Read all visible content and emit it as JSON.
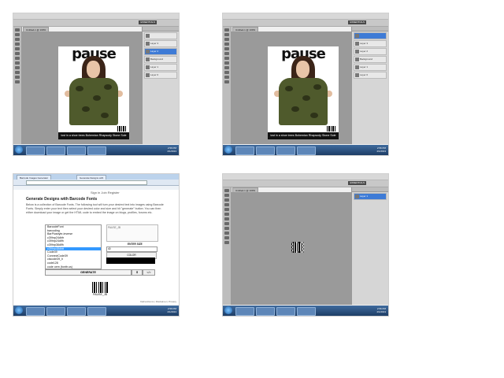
{
  "photoshop": {
    "menus": [
      "File",
      "Edit",
      "Image",
      "Layer",
      "Select",
      "Filter",
      "Analysis",
      "3D",
      "View",
      "Window",
      "Help"
    ],
    "workspace_label": "ESSENTIALS",
    "doc_tab": "Untitled-1 @ 100%",
    "layers_shot1": [
      "",
      "Layer 3",
      "Layer 2",
      "Background",
      "Layer 1",
      "Layer 0"
    ],
    "layers_shot2": [
      "",
      "Layer 3",
      "Layer 2",
      "Background",
      "Layer 1",
      "Layer 0"
    ],
    "layers_shot4": [
      "Layer 1"
    ]
  },
  "poster": {
    "title": "pause",
    "caption": "lost in a shoe trees   Bohemian Rhapsody   Stone Sole"
  },
  "taskbar": {
    "time": "2:56 PM",
    "date": "4/1/2013"
  },
  "browser": {
    "tab1": "Barcode Images Generator",
    "tab2": "Generate Designs with",
    "url": "",
    "bookmarks": "",
    "signin": "Sign in  Join  Register",
    "title": "Generate Designs with Barcode Fonts",
    "description": "Below is a collection of Barcode Fonts. The following tool will turn your desired text into images using Barcode Fonts. Simply enter your text then select your desired color and size and hit \"generate\" button. You can then either download your image or get the HTML code to embed the image on blogs, profiles, forums etc.",
    "fonts": [
      "BarcodeFont",
      "barcoding",
      "BarPlusbyte-inverse",
      "c39hrp24dhfr",
      "c39hrp24dlfh",
      "c39hrp36dlfh",
      "c39hrp48dhtt",
      "Code39",
      "ConnectCode39",
      "ciscode39_h",
      "code128",
      "code oem (fonttr.us)",
      "aaron-m289"
    ],
    "selected_font": "c39hrp48dhtt",
    "text_value": "PAUSE_JB",
    "size_label": "ENTER SIZE",
    "size_value": "40",
    "color_label": "COLOR",
    "generate_label": "GENERATE",
    "download_label": "⬇",
    "html_label": "</>",
    "result_text": "PAUSE_JB",
    "footer": "DaFontIcons  |  Disclaimer  |  Privacy"
  },
  "colors": {
    "ps_panel": "#d6d6d6",
    "ps_canvas": "#9a9a9a",
    "taskbar": "#1d3d66",
    "selection": "#3399ff"
  }
}
